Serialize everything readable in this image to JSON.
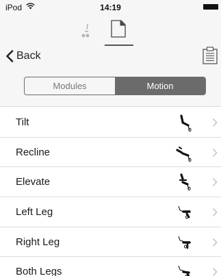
{
  "status_bar": {
    "device": "iPod",
    "time": "14:19"
  },
  "nav": {
    "back_label": "Back"
  },
  "segments": [
    {
      "label": "Modules",
      "selected": false
    },
    {
      "label": "Motion",
      "selected": true
    }
  ],
  "motion_list": [
    {
      "label": "Tilt",
      "icon": "tilt-icon"
    },
    {
      "label": "Recline",
      "icon": "recline-icon"
    },
    {
      "label": "Elevate",
      "icon": "elevate-icon"
    },
    {
      "label": "Left Leg",
      "icon": "left-leg-icon"
    },
    {
      "label": "Right Leg",
      "icon": "right-leg-icon"
    },
    {
      "label": "Both Legs",
      "icon": "both-legs-icon"
    }
  ],
  "colors": {
    "header_bg": "#f6f6f6",
    "segment_active": "#6b6b6b",
    "separator": "#dcdcdc"
  }
}
